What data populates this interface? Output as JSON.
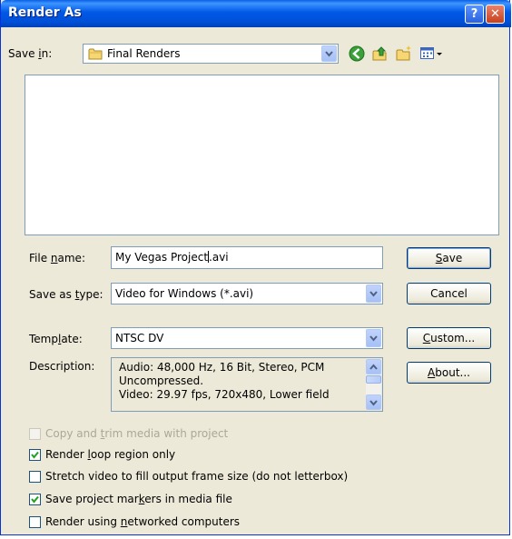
{
  "window": {
    "title": "Render As",
    "help_glyph": "?",
    "close_glyph": "✕"
  },
  "save_in": {
    "label_pre": "Save ",
    "label_u": "i",
    "label_post": "n:",
    "value": "Final Renders"
  },
  "toolbar": {
    "icons": [
      "back-icon",
      "up-folder-icon",
      "new-folder-icon",
      "view-menu-icon"
    ]
  },
  "file_name": {
    "label_pre": "File ",
    "label_u": "n",
    "label_post": "ame:",
    "value_pre": "My Vegas Project",
    "value_post": ".avi"
  },
  "save_as_type": {
    "label_pre": "Save as ",
    "label_u": "t",
    "label_post": "ype:",
    "value": "Video for Windows (*.avi)"
  },
  "template": {
    "label_pre": "Temp",
    "label_u": "l",
    "label_post": "ate:",
    "value": "NTSC DV"
  },
  "description": {
    "label": "Description:",
    "text": "Audio: 48,000 Hz, 16 Bit, Stereo, PCM Uncompressed.\nVideo: 29.97 fps, 720x480, Lower field"
  },
  "buttons": {
    "save": {
      "u": "S",
      "rest": "ave"
    },
    "cancel": "Cancel",
    "custom": {
      "u": "C",
      "rest": "ustom..."
    },
    "about": {
      "u": "A",
      "rest": "bout..."
    }
  },
  "options": [
    {
      "pre": "Copy and ",
      "u": "t",
      "post": "rim media with project",
      "checked": false,
      "enabled": false
    },
    {
      "pre": "Render ",
      "u": "l",
      "post": "oop region only",
      "checked": true,
      "enabled": true
    },
    {
      "pre": "Stretch video to fill output frame size (do not letterbox)",
      "u": "",
      "post": "",
      "checked": false,
      "enabled": true
    },
    {
      "pre": "Save project mar",
      "u": "k",
      "post": "ers in media file",
      "checked": true,
      "enabled": true
    },
    {
      "pre": "Render using ",
      "u": "n",
      "post": "etworked computers",
      "checked": false,
      "enabled": true
    }
  ],
  "colors": {
    "titlebar": "#0058e6",
    "dialog_bg": "#ece9d8",
    "field_border": "#7f9db9",
    "check": "#21a121"
  }
}
